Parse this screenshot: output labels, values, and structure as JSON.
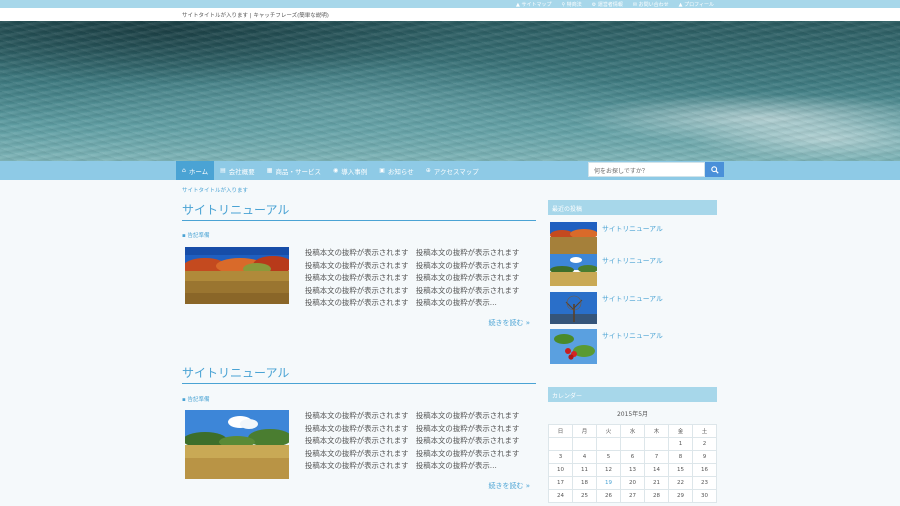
{
  "topbar": {
    "links": [
      {
        "icon": "user-icon",
        "label": "サイトマップ"
      },
      {
        "icon": "search-icon",
        "label": "特商法"
      },
      {
        "icon": "gear-icon",
        "label": "運営者情報"
      },
      {
        "icon": "mail-icon",
        "label": "お問い合わせ"
      },
      {
        "icon": "user-icon",
        "label": "プロフィール"
      }
    ]
  },
  "site": {
    "title_line": "サイトタイトルが入ります | キャッチフレーズ(簡単な説明)"
  },
  "nav": {
    "items": [
      {
        "icon": "home-icon",
        "label": "ホーム"
      },
      {
        "icon": "document-icon",
        "label": "会社概要"
      },
      {
        "icon": "boxes-icon",
        "label": "商品・サービス"
      },
      {
        "icon": "pin-icon",
        "label": "導入事例"
      },
      {
        "icon": "news-icon",
        "label": "お知らせ"
      },
      {
        "icon": "globe-icon",
        "label": "アクセスマップ"
      }
    ],
    "search_placeholder": "何をお探しですか？"
  },
  "breadcrumb": "サイトタイトルが入ります",
  "posts": [
    {
      "title": "サイトリニューアル",
      "category": "告記準備",
      "excerpt_lines": [
        "投稿本文の抜粋が表示されます　投稿本文の抜粋が表示されます",
        "投稿本文の抜粋が表示されます　投稿本文の抜粋が表示されます",
        "投稿本文の抜粋が表示されます　投稿本文の抜粋が表示されます",
        "投稿本文の抜粋が表示されます　投稿本文の抜粋が表示されます",
        "投稿本文の抜粋が表示されます　投稿本文の抜粋が表示..."
      ],
      "more": "続きを読む »"
    },
    {
      "title": "サイトリニューアル",
      "category": "告記準備",
      "excerpt_lines": [
        "投稿本文の抜粋が表示されます　投稿本文の抜粋が表示されます",
        "投稿本文の抜粋が表示されます　投稿本文の抜粋が表示されます",
        "投稿本文の抜粋が表示されます　投稿本文の抜粋が表示されます",
        "投稿本文の抜粋が表示されます　投稿本文の抜粋が表示されます",
        "投稿本文の抜粋が表示されます　投稿本文の抜粋が表示..."
      ],
      "more": "続きを読む »"
    }
  ],
  "sidebar": {
    "recent_heading": "最近の投稿",
    "recent": [
      {
        "label": "サイトリニューアル"
      },
      {
        "label": "サイトリニューアル"
      },
      {
        "label": "サイトリニューアル"
      },
      {
        "label": "サイトリニューアル"
      }
    ],
    "calendar_heading": "カレンダー",
    "calendar": {
      "caption": "2015年5月",
      "weekdays": [
        "日",
        "月",
        "火",
        "水",
        "木",
        "金",
        "土"
      ],
      "weeks": [
        [
          "",
          "",
          "",
          "",
          "",
          "1",
          "2"
        ],
        [
          "3",
          "4",
          "5",
          "6",
          "7",
          "8",
          "9"
        ],
        [
          "10",
          "11",
          "12",
          "13",
          "14",
          "15",
          "16"
        ],
        [
          "17",
          "18",
          "19",
          "20",
          "21",
          "22",
          "23"
        ],
        [
          "24",
          "25",
          "26",
          "27",
          "28",
          "29",
          "30"
        ]
      ],
      "highlight_day": "19"
    }
  },
  "colors": {
    "accent": "#4aa3d4",
    "nav_bg": "#8ecae6",
    "topbar_bg": "#a7d7ea"
  }
}
